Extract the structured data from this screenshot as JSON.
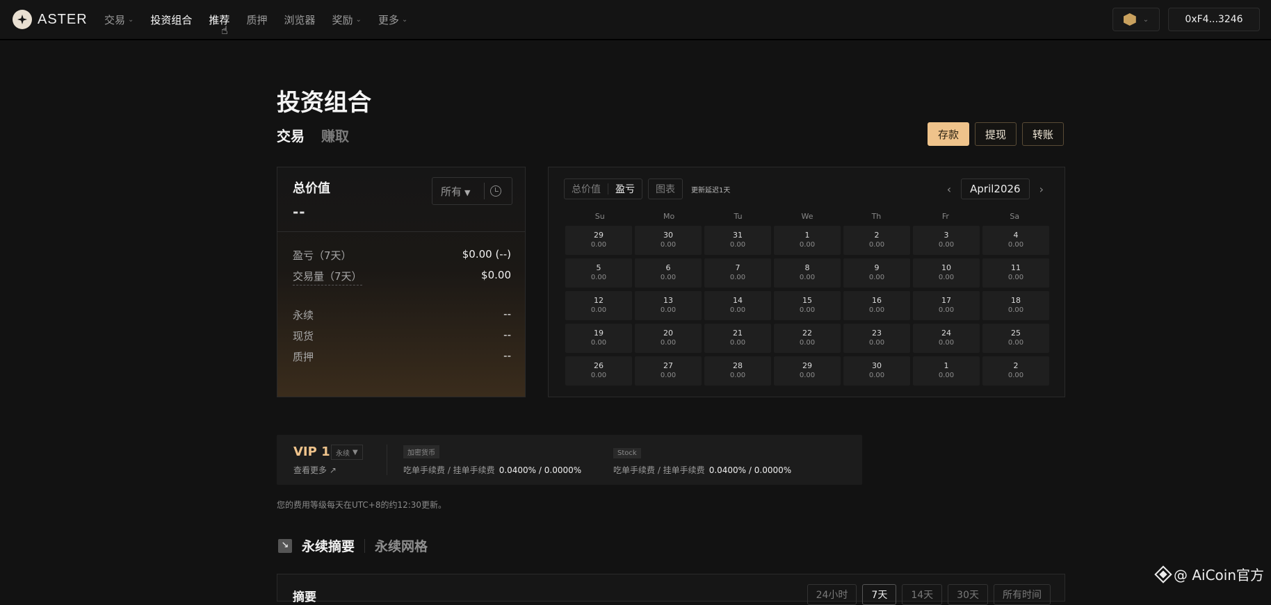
{
  "topbar": {
    "logo_text": "ASTER",
    "nav": [
      {
        "label": "交易",
        "dropdown": true,
        "active": false
      },
      {
        "label": "投资组合",
        "dropdown": false,
        "active": true
      },
      {
        "label": "推荐",
        "dropdown": false,
        "active": true
      },
      {
        "label": "质押",
        "dropdown": false,
        "active": false
      },
      {
        "label": "浏览器",
        "dropdown": false,
        "active": false
      },
      {
        "label": "奖励",
        "dropdown": true,
        "active": false
      },
      {
        "label": "更多",
        "dropdown": true,
        "active": false
      }
    ],
    "chevron": "⌄",
    "network_chevron": "⌄",
    "wallet": "0xF4...3246"
  },
  "page": {
    "title": "投资组合",
    "tabs": [
      "交易",
      "赚取"
    ],
    "actions": {
      "deposit": "存款",
      "withdraw": "提现",
      "transfer": "转账"
    }
  },
  "total": {
    "title": "总价值",
    "value": "--",
    "filter": "所有",
    "pnl_label": "盈亏（7天）",
    "pnl_value": "$0.00 (--)",
    "volume_label": "交易量（7天）",
    "volume_value": "$0.00",
    "perp_label": "永续",
    "perp_value": "--",
    "spot_label": "现货",
    "spot_value": "--",
    "stake_label": "质押",
    "stake_value": "--"
  },
  "calendar": {
    "seg1": [
      "总价值",
      "盈亏"
    ],
    "seg2": "图表",
    "note": "更新延迟1天",
    "month": "April2026",
    "prev": "‹",
    "next": "›",
    "weekdays": [
      "Su",
      "Mo",
      "Tu",
      "We",
      "Th",
      "Fr",
      "Sa"
    ],
    "days": [
      "29",
      "30",
      "31",
      "1",
      "2",
      "3",
      "4",
      "5",
      "6",
      "7",
      "8",
      "9",
      "10",
      "11",
      "12",
      "13",
      "14",
      "15",
      "16",
      "17",
      "18",
      "19",
      "20",
      "21",
      "22",
      "23",
      "24",
      "25",
      "26",
      "27",
      "28",
      "29",
      "30",
      "1",
      "2"
    ],
    "day_value": "0.00"
  },
  "vip": {
    "level": "VIP 1",
    "selector": "永续",
    "more": "查看更多 ↗",
    "crypto_tag": "加密货币",
    "crypto_label": "吃单手续费 / 挂单手续费",
    "crypto_fee": "0.0400% / 0.0000%",
    "stock_tag": "Stock",
    "stock_label": "吃单手续费 / 挂单手续费",
    "stock_fee": "0.0400% / 0.0000%",
    "note": "您的费用等级每天在UTC+8的约12:30更新。"
  },
  "summary": {
    "icon": "↘",
    "tab_on": "永续摘要",
    "tab_off": "永续网格",
    "title": "摘要",
    "ranges": [
      "24小时",
      "7天",
      "14天",
      "30天",
      "所有时间"
    ],
    "active_range": "7天"
  },
  "watermark": "@ AiCoin官方"
}
